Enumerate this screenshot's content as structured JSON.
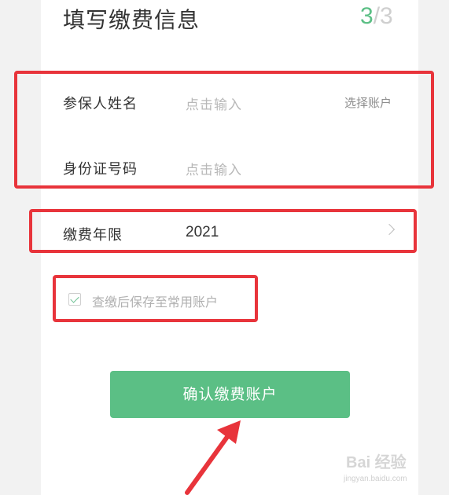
{
  "header": {
    "title": "填写缴费信息",
    "step_current": "3",
    "step_sep": "/",
    "step_total": "3"
  },
  "form": {
    "name_label": "参保人姓名",
    "name_placeholder": "点击输入",
    "select_account": "选择账户",
    "id_label": "身份证号码",
    "id_placeholder": "点击输入",
    "year_label": "缴费年限",
    "year_value": "2021"
  },
  "save_option": {
    "checked": true,
    "label": "查缴后保存至常用账户"
  },
  "confirm_label": "确认缴费账户",
  "watermark": {
    "brand": "Bai 经验",
    "url": "jingyan.baidu.com"
  },
  "colors": {
    "accent": "#5bbf85",
    "highlight": "#e8343b"
  }
}
